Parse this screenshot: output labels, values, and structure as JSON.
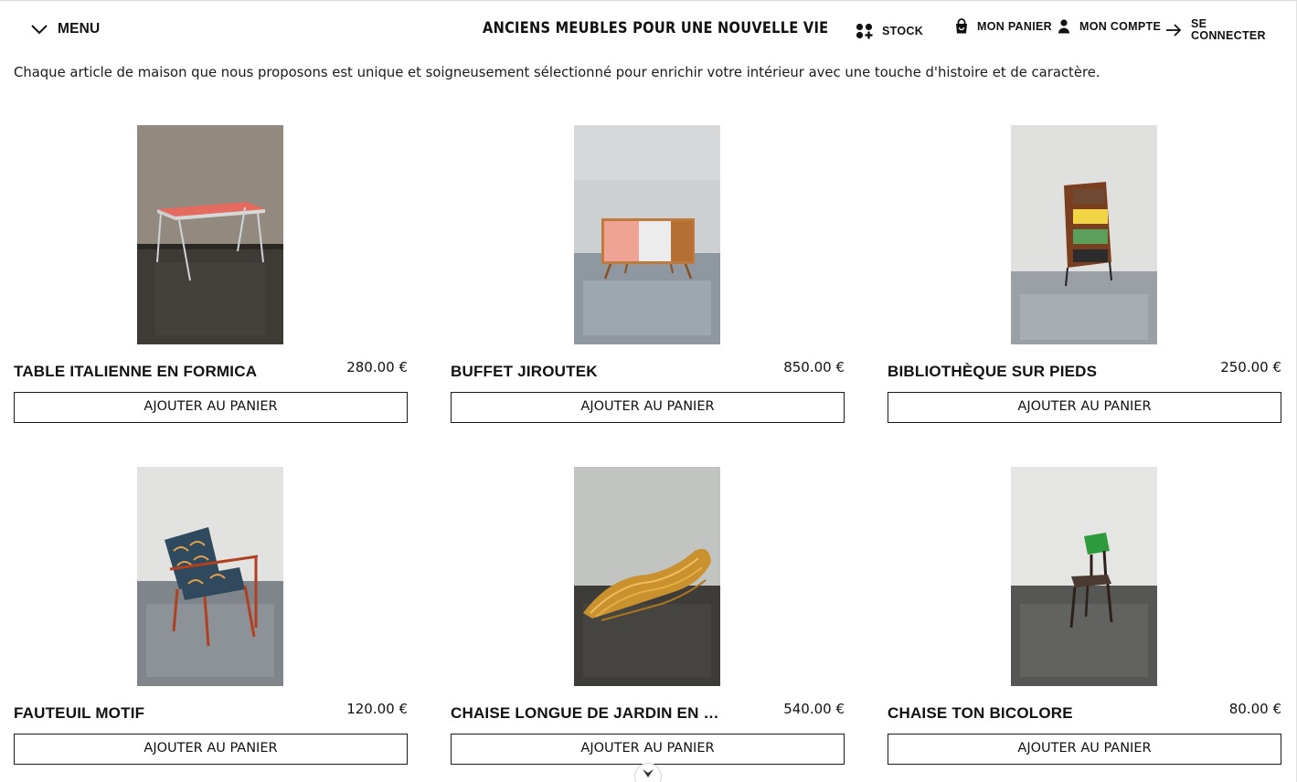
{
  "header": {
    "menu_label": "MENU",
    "site_title": "ANCIENS MEUBLES POUR UNE NOUVELLE VIE",
    "nav": {
      "stock": "STOCK",
      "cart": "MON PANIER",
      "account": "MON COMPTE",
      "login": "SE CONNECTER"
    }
  },
  "intro": "Chaque article de maison que nous proposons est unique et soigneusement sélectionné pour enrichir votre intérieur avec une touche d'histoire et de caractère.",
  "products": [
    {
      "name": "TABLE ITALIENNE EN FORMICA",
      "price": "280.00 €",
      "button": "AJOUTER AU PANIER"
    },
    {
      "name": "BUFFET JIROUTEK",
      "price": "850.00 €",
      "button": "AJOUTER AU PANIER"
    },
    {
      "name": "BIBLIOTHÈQUE SUR PIEDS",
      "price": "250.00 €",
      "button": "AJOUTER AU PANIER"
    },
    {
      "name": "FAUTEUIL MOTIF",
      "price": "120.00 €",
      "button": "AJOUTER AU PANIER"
    },
    {
      "name": "CHAISE LONGUE DE JARDIN EN R...",
      "price": "540.00 €",
      "button": "AJOUTER AU PANIER"
    },
    {
      "name": "CHAISE TON BICOLORE",
      "price": "80.00 €",
      "button": "AJOUTER AU PANIER"
    }
  ],
  "icons": {
    "menu": "chevron-down-icon",
    "stock": "grid-plus-icon",
    "cart": "bag-icon",
    "account": "user-icon",
    "login": "arrow-right-icon",
    "scroll": "chevron-down-icon"
  },
  "colors": {
    "text": "#111111",
    "background": "#ffffff",
    "button_border": "#1a1a1a"
  }
}
